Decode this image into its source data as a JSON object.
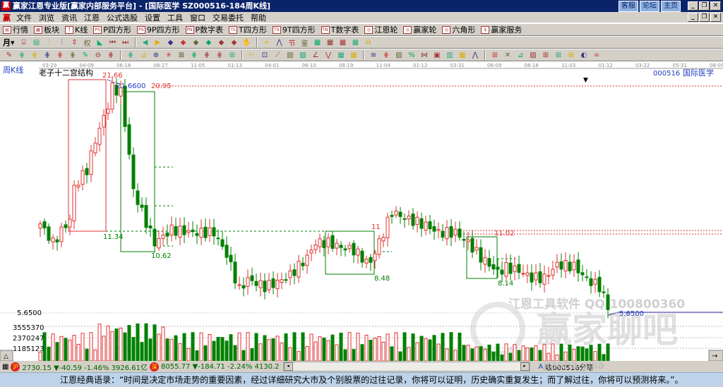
{
  "window": {
    "title": "赢家江恩专业版[赢家内部服务平台] - [国际医学   SZ000516-184周K线]",
    "logo": "赢",
    "links": [
      "客服",
      "论坛",
      "主页"
    ],
    "buttons": [
      "_",
      "❐",
      "✕"
    ]
  },
  "menu": {
    "items": [
      "文件",
      "浏览",
      "资讯",
      "江恩",
      "公式选股",
      "设置",
      "工具",
      "窗口",
      "交易委托",
      "帮助"
    ],
    "buttons": [
      "_",
      "❐",
      "✕"
    ]
  },
  "toolbar1": [
    {
      "label": "行情",
      "icon": "quote-icon",
      "glyph": "▤"
    },
    {
      "label": "板块",
      "icon": "sector-icon",
      "glyph": "▦"
    },
    {
      "label": "K线",
      "icon": "kline-icon",
      "glyph": "╿"
    },
    {
      "label": "P四方形",
      "icon": "ps-icon",
      "glyph": "PS"
    },
    {
      "label": "9P四方形",
      "icon": "p9-icon",
      "glyph": "P9"
    },
    {
      "label": "P数字表",
      "icon": "pn-icon",
      "glyph": "PN"
    },
    {
      "label": "T四方形",
      "icon": "ts-icon",
      "glyph": "TS"
    },
    {
      "label": "9T四方形",
      "icon": "t9-icon",
      "glyph": "T9"
    },
    {
      "label": "T数字表",
      "icon": "tn-icon",
      "glyph": "TN"
    },
    {
      "label": "江恩轮",
      "icon": "gann-wheel-icon",
      "glyph": "◎"
    },
    {
      "label": "赢家轮",
      "icon": "winner-wheel-icon",
      "glyph": "◎"
    },
    {
      "label": "六角形",
      "icon": "hexagon-icon",
      "glyph": "◎"
    },
    {
      "label": "赢家服务",
      "icon": "service-icon",
      "glyph": "$"
    }
  ],
  "toolbar2": {
    "period": "月",
    "glyphs": [
      "⌸",
      "▤",
      "⫶",
      "⫶",
      "⇕",
      "权",
      "◣",
      "⏮",
      "⏭",
      "◀",
      "▶",
      "◆",
      "◆",
      "◆",
      "◆",
      "◆",
      "◆",
      "✋",
      "+",
      "⋀",
      "节",
      "鉴",
      "▦",
      "▦",
      "▦",
      "▦",
      "⧉"
    ]
  },
  "toolbar3": {
    "glyphs": [
      "✎",
      "⋕",
      "⋕",
      "⋕",
      "⋕",
      "⋕",
      "✎",
      "⊖",
      "⋕",
      "⋕",
      "⊿",
      "⊕",
      "✳",
      "⊠",
      "⋕",
      "⋕",
      "⋕",
      "⊞",
      "⊢",
      "⊡",
      "⟋",
      "▨",
      "▨",
      "∠",
      "⋁",
      "▦",
      "▦",
      "≋",
      "⋕",
      "▨",
      "%",
      "⋈",
      "▣",
      "▥",
      "▦",
      "⋀",
      "⊞",
      "✕",
      "⊿",
      "▨",
      "⊞",
      "⊞",
      "⊞",
      "◐",
      "∞"
    ]
  },
  "chart": {
    "period_label": "周K线",
    "structure_label": "老子十二宫结构",
    "stock_code": "000516",
    "stock_name": "国际医学",
    "dates": [
      "03-29",
      "04-09",
      "06-18",
      "08-27",
      "11-05",
      "01-13",
      "04-01",
      "06-10",
      "08-19",
      "11-04",
      "01-12",
      "03-31",
      "06-09",
      "08-18",
      "11-03",
      "01-12",
      "03-22",
      "05-31",
      "08-09"
    ],
    "annotations": {
      "high": "21.66",
      "high_price": "21.6600",
      "level_a": "20.95",
      "level_b": "11.34",
      "level_c": "10.62",
      "level_d": "11",
      "level_e": "8.48",
      "level_f": "11.02",
      "level_g": "8.14",
      "low_price": "5.6500"
    },
    "axis_low": "5.6500",
    "vol_ticks": [
      "3555370",
      "2370247",
      "1185123"
    ],
    "watermark1": "江恩工具软件  QQ:100800360",
    "watermark2": "赢家聊吧",
    "watermark3": "jiaoba.yijia"
  },
  "chart_data": {
    "type": "candlestick",
    "x_unit": "week index",
    "close_waypoints": [
      [
        0,
        11.8
      ],
      [
        3,
        10.5
      ],
      [
        7,
        12.1
      ],
      [
        8,
        14.3
      ],
      [
        11,
        15.5
      ],
      [
        13,
        17.5
      ],
      [
        16,
        19.9
      ],
      [
        17,
        21.1
      ],
      [
        19,
        20.8
      ],
      [
        21,
        16.5
      ],
      [
        22,
        14.1
      ],
      [
        24,
        12.6
      ],
      [
        27,
        10.5
      ],
      [
        31,
        11.4
      ],
      [
        36,
        11.2
      ],
      [
        41,
        11.2
      ],
      [
        44,
        9.7
      ],
      [
        47,
        7.3
      ],
      [
        49,
        8.0
      ],
      [
        53,
        7.5
      ],
      [
        56,
        7.8
      ],
      [
        59,
        8.3
      ],
      [
        63,
        9.5
      ],
      [
        65,
        10.5
      ],
      [
        68,
        10.5
      ],
      [
        71,
        10.2
      ],
      [
        74,
        10.0
      ],
      [
        77,
        9.2
      ],
      [
        78,
        9.2
      ],
      [
        81,
        11.2
      ],
      [
        83,
        12.6
      ],
      [
        87,
        12.1
      ],
      [
        91,
        11.7
      ],
      [
        94,
        11.2
      ],
      [
        98,
        11.2
      ],
      [
        101,
        10.5
      ],
      [
        104,
        9.5
      ],
      [
        108,
        8.5
      ],
      [
        110,
        8.8
      ],
      [
        113,
        8.6
      ],
      [
        116,
        8.1
      ],
      [
        119,
        8.1
      ],
      [
        122,
        9.0
      ],
      [
        126,
        8.9
      ],
      [
        129,
        8.0
      ],
      [
        132,
        7.5
      ],
      [
        134,
        6.1
      ]
    ],
    "price_range": [
      5.65,
      21.66
    ],
    "volume_range": [
      0,
      5000000
    ],
    "colors": {
      "up": "#e03030",
      "down": "#008000"
    }
  },
  "status": {
    "sh_index": "2730.15 ▼-40.59 -1.46% 3926.61亿",
    "sz_index": "8055.77 ▼-184.71 -2.24% 4130.2",
    "sh_icon": "沪",
    "sz_icon": "深",
    "right": "收000516分笔"
  },
  "quote": "江恩经典语录：“时间是决定市场走势的重要因素，经过详细研究大市及个别股票的过往记录，你将可以证明，历史确实重复发生；而了解过往，你将可以预测将来。”。"
}
